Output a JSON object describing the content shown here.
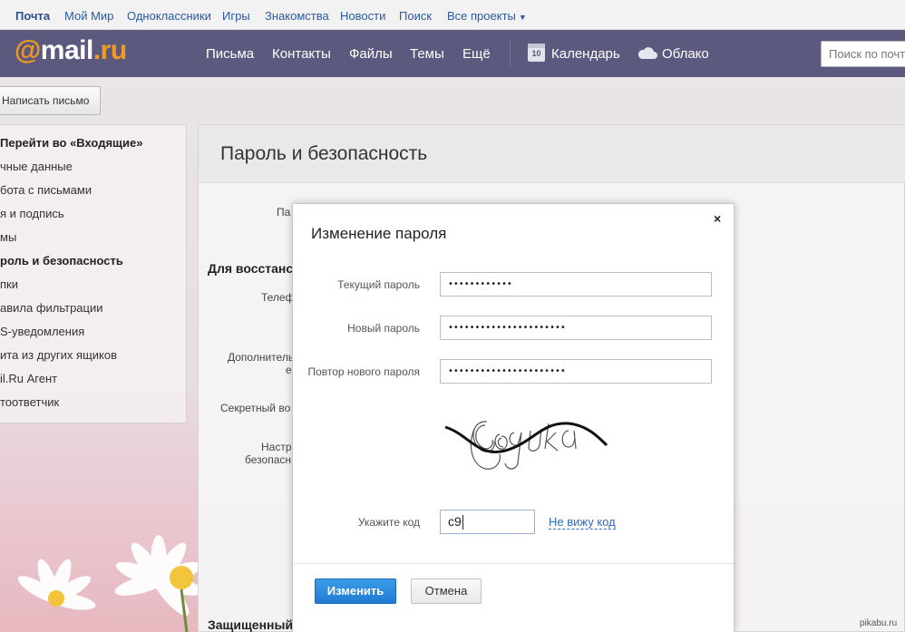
{
  "portal": {
    "links": [
      "Почта",
      "Мой Мир",
      "Одноклассники",
      "Игры",
      "Знакомства",
      "Новости",
      "Поиск",
      "Все проекты"
    ]
  },
  "header": {
    "logo_at": "@",
    "logo_mail": "mail",
    "logo_dot": ".",
    "logo_ru": "ru",
    "nav": [
      "Письма",
      "Контакты",
      "Файлы",
      "Темы",
      "Ещё"
    ],
    "calendar_day": "10",
    "calendar_label": "Календарь",
    "cloud_label": "Облако",
    "search_placeholder": "Поиск по почте"
  },
  "toolbar": {
    "write_label": "Написать письмо"
  },
  "menu": {
    "items": [
      "Перейти во «Входящие»",
      "чные данные",
      "бота с письмами",
      "я и подпись",
      "мы",
      "роль и безопасность",
      "пки",
      "авила фильтрации",
      "S-уведомления",
      "ита из других ящиков",
      "il.Ru Агент",
      "тоответчик"
    ]
  },
  "content": {
    "title": "Пароль и безопасность",
    "labels": {
      "pa": "Па",
      "recovery": "Для восстанс",
      "phone": "Телеф",
      "extra_1": "Дополнитель",
      "extra_2": "е",
      "secret": "Секретный во",
      "settings_1": "Настр",
      "settings_2": "безопасн",
      "sms": "Защищенный вход с подтверждением по SMS"
    }
  },
  "modal": {
    "title": "Изменение пароля",
    "close": "×",
    "current_label": "Текущий пароль",
    "current_value": "••••••••••••",
    "new_label": "Новый пароль",
    "new_value": "••••••••••••••••••••••",
    "repeat_label": "Повтор нового пароля",
    "repeat_value": "••••••••••••••••••••••",
    "code_label": "Укажите код",
    "code_value": "с9",
    "no_code_link": "Не вижу код",
    "submit_label": "Изменить",
    "cancel_label": "Отмена"
  },
  "watermark": "pikabu.ru",
  "colors": {
    "header": "#5b5a7e",
    "logo_accent": "#f29a1f",
    "primary_button": "#1f7bd1",
    "link": "#2b6bbd"
  },
  "icons": [
    "calendar-icon",
    "cloud-icon",
    "caret-down-icon",
    "close-icon",
    "captcha-image"
  ]
}
